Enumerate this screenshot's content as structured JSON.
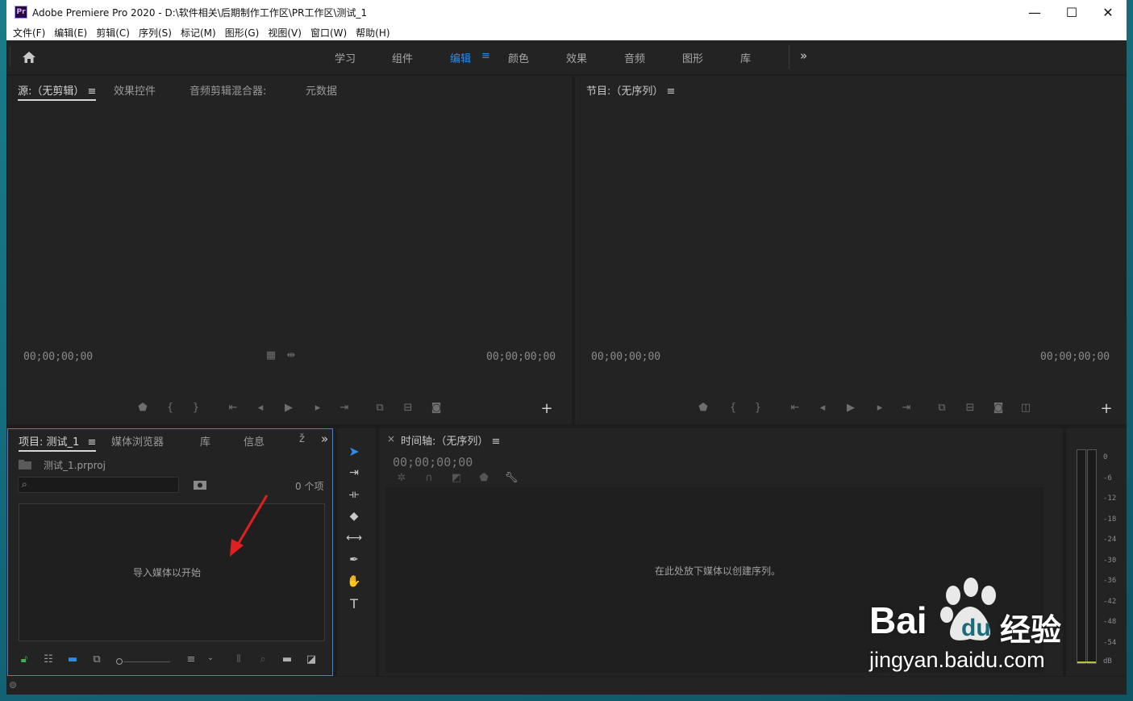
{
  "app": {
    "logo_text": "Pr",
    "title": "Adobe Premiere Pro 2020 - D:\\软件相关\\后期制作工作区\\PR工作区\\测试_1",
    "window_controls": [
      "minimize-icon",
      "maximize-icon",
      "close-icon"
    ]
  },
  "menu": [
    "文件(F)",
    "编辑(E)",
    "剪辑(C)",
    "序列(S)",
    "标记(M)",
    "图形(G)",
    "视图(V)",
    "窗口(W)",
    "帮助(H)"
  ],
  "workspaces": {
    "tabs": [
      "学习",
      "组件",
      "编辑",
      "颜色",
      "效果",
      "音频",
      "图形",
      "库"
    ],
    "active": "编辑",
    "menu_glyph": "≡",
    "overflow_glyph": "»",
    "accent_color": "#2d8ceb"
  },
  "source_panel": {
    "tabs": [
      "源:（无剪辑）",
      "效果控件",
      "音频剪辑混合器:",
      "元数据"
    ],
    "menu_glyph": "≡",
    "timecode_left": "00;00;00;00",
    "timecode_right": "00;00;00;00"
  },
  "program_panel": {
    "title": "节目:（无序列）",
    "menu_glyph": "≡",
    "timecode_left": "00;00;00;00",
    "timecode_right": "00;00;00;00"
  },
  "transport": {
    "source_icons": [
      "marker-icon",
      "mark-in-icon",
      "mark-out-icon",
      "go-to-in-icon",
      "step-back-icon",
      "play-icon",
      "step-forward-icon",
      "go-to-out-icon",
      "insert-icon",
      "overwrite-icon",
      "export-frame-icon"
    ],
    "program_icons": [
      "marker-icon",
      "mark-in-icon",
      "mark-out-icon",
      "go-to-in-icon",
      "step-back-icon",
      "play-icon",
      "step-forward-icon",
      "go-to-out-icon",
      "lift-icon",
      "extract-icon",
      "export-frame-icon",
      "comparison-view-icon"
    ],
    "add_button": "+"
  },
  "project_panel": {
    "tabs": [
      "项目: 测试_1",
      "媒体浏览器",
      "库",
      "信息",
      "ž"
    ],
    "menu_glyph": "≡",
    "overflow_glyph": "»",
    "file_name": "测试_1.prproj",
    "search_placeholder": "",
    "item_count": "0 个项",
    "empty_text": "导入媒体以开始",
    "bin_accent": "#2d8ceb"
  },
  "tools": [
    "selection-tool-icon",
    "track-select-icon",
    "ripple-edit-icon",
    "razor-icon",
    "slip-icon",
    "pen-icon",
    "hand-icon",
    "type-icon"
  ],
  "timeline": {
    "close_glyph": "×",
    "title": "时间轴:（无序列）",
    "menu_glyph": "≡",
    "timecode": "00;00;00;00",
    "empty_text": "在此处放下媒体以创建序列。"
  },
  "audio_meter": {
    "scale": [
      "0",
      "-6",
      "-12",
      "-18",
      "-24",
      "-30",
      "-36",
      "-42",
      "-48",
      "-54",
      "dB"
    ]
  },
  "annotation": {
    "arrow_color": "#e02020"
  },
  "watermark": {
    "brand_bai": "Bai",
    "brand_du": "du",
    "brand_jingyan": "经验",
    "url": "jingyan.baidu.com"
  }
}
